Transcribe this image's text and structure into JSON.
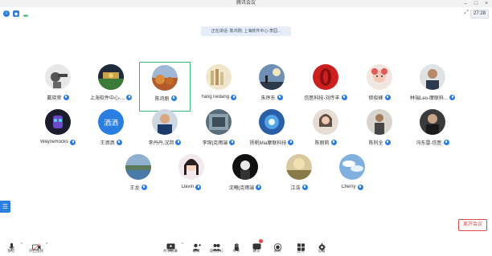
{
  "window": {
    "title": "腾讯会议",
    "timer": "27:28"
  },
  "banner": {
    "speaking": "正在讲话: 陈鸿刚; 上海软件中心-李园..."
  },
  "participants": [
    {
      "name": "戴晓荣"
    },
    {
      "name": "上海软件中心-..."
    },
    {
      "name": "陈鸿刚"
    },
    {
      "name": "YangTiedang"
    },
    {
      "name": "朱序东"
    },
    {
      "name": "信医科技-刘传丰"
    },
    {
      "name": "修俊峰"
    },
    {
      "name": "林瑞Leo-摩联科..."
    },
    {
      "name": "WayneRocks"
    },
    {
      "name": "王洒洒"
    },
    {
      "name": "李丹丹,汉邦"
    },
    {
      "name": "李琛|克雨端"
    },
    {
      "name": "扬帆Mia摩联科技"
    },
    {
      "name": "陈丽莉"
    },
    {
      "name": "陈利全"
    },
    {
      "name": "冯东雷-信医"
    },
    {
      "name": "王龙"
    },
    {
      "name": "Davin"
    },
    {
      "name": "沈曦|克雨端"
    },
    {
      "name": "江浩"
    },
    {
      "name": "Cherry"
    }
  ],
  "avatar_texts": {
    "wangsasa": "洒洒"
  },
  "toolbar": {
    "mute": "静音",
    "video": "开启视频",
    "share": "共享屏幕",
    "invite": "邀请",
    "members": "成员(21)",
    "raise": "举手",
    "chat": "聊天",
    "record": "录制",
    "apps": "应用",
    "settings": "设置",
    "leave": "离开会议"
  },
  "colors": {
    "accent": "#2a7de1",
    "active_border": "#3cb371",
    "leave": "#e34a4a"
  }
}
